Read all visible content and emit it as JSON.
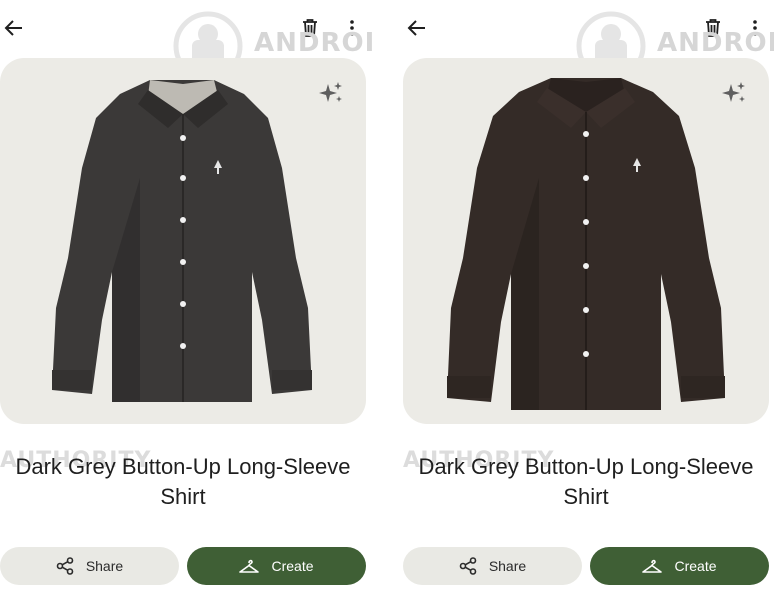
{
  "panels": [
    {
      "title": "Dark Grey Button-Up Long-Sleeve Shirt",
      "share_label": "Share",
      "create_label": "Create",
      "shirt_color": "#3b3938",
      "shirt_shade": "#2c2a29",
      "collar_inner": "#bdbab3",
      "back_icon": "arrow-left-icon",
      "delete_icon": "trash-icon",
      "menu_icon": "more-vert-icon",
      "enhance_icon": "sparkle-icon"
    },
    {
      "title": "Dark Grey Button-Up Long-Sleeve Shirt",
      "share_label": "Share",
      "create_label": "Create",
      "shirt_color": "#342b27",
      "shirt_shade": "#271f1c",
      "collar_inner": "#2a221f",
      "back_icon": "arrow-left-icon",
      "delete_icon": "trash-icon",
      "menu_icon": "more-vert-icon",
      "enhance_icon": "sparkle-icon"
    }
  ],
  "watermark": {
    "brand_top": "ANDROID",
    "brand_bottom": "AUTHORITY"
  },
  "colors": {
    "accent": "#3f5f35",
    "card_bg": "#ecebe6",
    "share_bg": "#e9e9e4"
  }
}
